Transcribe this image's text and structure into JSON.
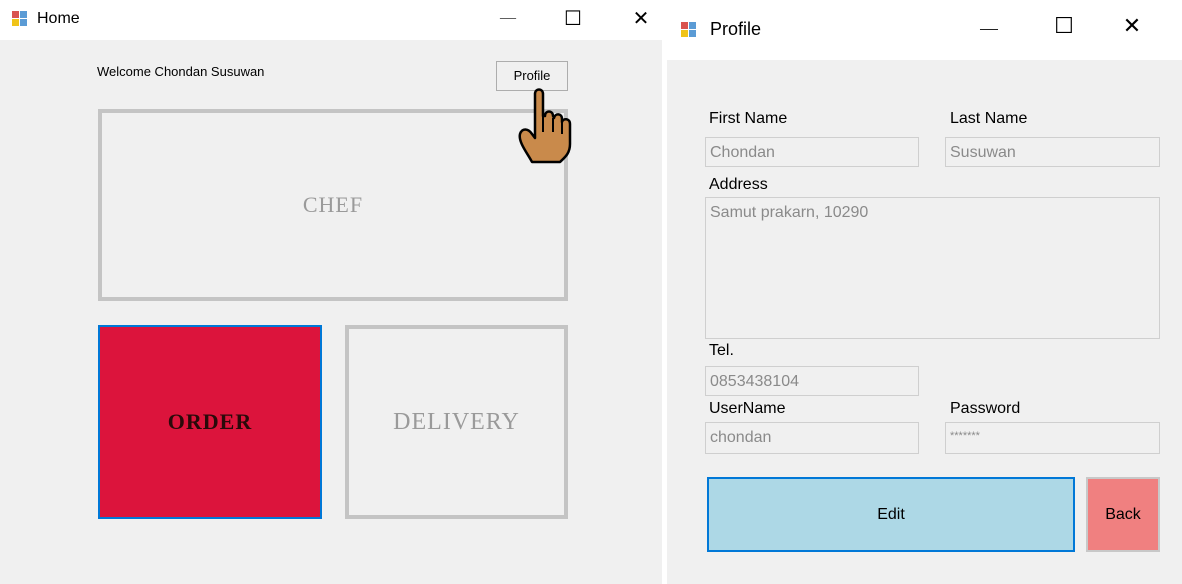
{
  "home": {
    "title": "Home",
    "controls": {
      "minimize": "—",
      "maximize": "☐",
      "close": "✕"
    },
    "welcome": "Welcome Chondan Susuwan",
    "profile_button": "Profile",
    "tiles": {
      "chef": "CHEF",
      "order": "ORDER",
      "delivery": "DELIVERY"
    }
  },
  "profile": {
    "title": "Profile",
    "controls": {
      "minimize": "—",
      "maximize": "☐",
      "close": "✕"
    },
    "fields": {
      "first_name": {
        "label": "First Name",
        "value": "Chondan"
      },
      "last_name": {
        "label": "Last Name",
        "value": "Susuwan"
      },
      "address": {
        "label": "Address",
        "value": "Samut prakarn, 10290"
      },
      "tel": {
        "label": "Tel.",
        "value": "0853438104"
      },
      "username": {
        "label": "UserName",
        "value": "chondan"
      },
      "password": {
        "label": "Password",
        "value": "*******"
      }
    },
    "edit_button": "Edit",
    "back_button": "Back"
  },
  "colors": {
    "order_tile": "#dc143c",
    "edit_button": "#add8e6",
    "back_button": "#f08080",
    "focus_border": "#0078d7"
  }
}
